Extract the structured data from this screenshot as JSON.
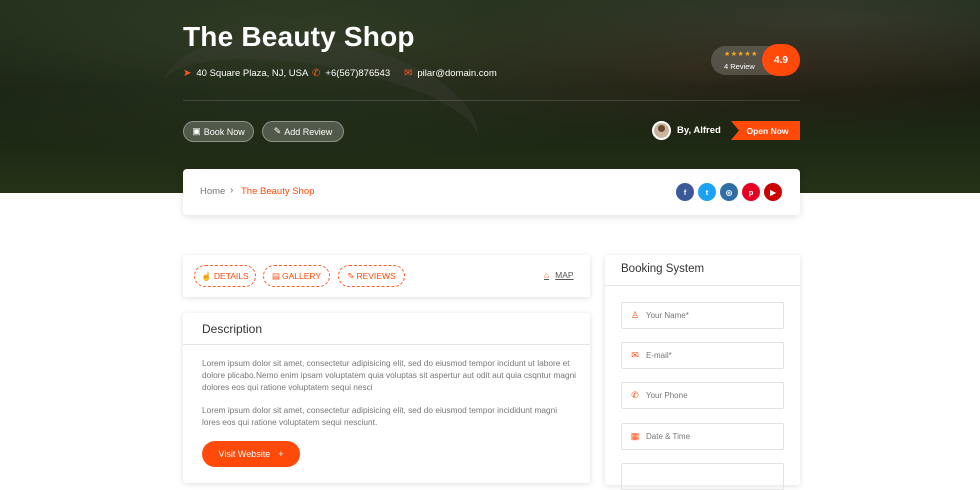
{
  "hero": {
    "title": "The Beauty Shop",
    "address": "40 Square Plaza, NJ, USA",
    "phone": "+6(567)876543",
    "email": "pilar@domain.com",
    "rating_stars": "★★★★★",
    "reviews_label": "4 Review",
    "score": "4.9",
    "book_now_label": "Book Now",
    "add_review_label": "Add Review",
    "author": "By, Alfred",
    "status": "Open Now"
  },
  "breadcrumb": {
    "home": "Home",
    "separator": "›",
    "current": "The Beauty Shop"
  },
  "social": [
    {
      "icon": "facebook-icon",
      "glyph": "f",
      "color": "#3b5998"
    },
    {
      "icon": "twitter-icon",
      "glyph": "t",
      "color": "#1da1f2"
    },
    {
      "icon": "instagram-icon",
      "glyph": "◎",
      "color": "#2e6ea6"
    },
    {
      "icon": "pinterest-icon",
      "glyph": "p",
      "color": "#e60023"
    },
    {
      "icon": "youtube-icon",
      "glyph": "▶",
      "color": "#cc0000"
    }
  ],
  "tabs": {
    "details": "DETAILS",
    "gallery": "GALLERY",
    "reviews": "REVIEWS",
    "map": "MAP"
  },
  "description": {
    "title": "Description",
    "para1": "Lorem ipsum dolor sit amet, consectetur adipisicing elit, sed do eiusmod tempor incidunt ut labore et dolore plicabo.Nemo enim ipsam voluptatem quia voluptas sit aspertur aut odit aut quia csqntur magni dolores eos qui ratione voluptatem sequi nesci",
    "para2": "Lorem ipsum dolor sit amet, consectetur adipisicing elit, sed do eiusmod tempor incididunt magni lores eos qui ratione voluptatem sequi nesciunt.",
    "visit_label": "Visit Website",
    "visit_plus": "+"
  },
  "booking": {
    "title": "Booking System",
    "fields": {
      "name": "Your Name*",
      "email": "E-mail*",
      "phone": "Your Phone",
      "datetime": "Date & Time"
    }
  },
  "colors": {
    "accent": "#ff4a0a",
    "star": "#f5a623"
  }
}
